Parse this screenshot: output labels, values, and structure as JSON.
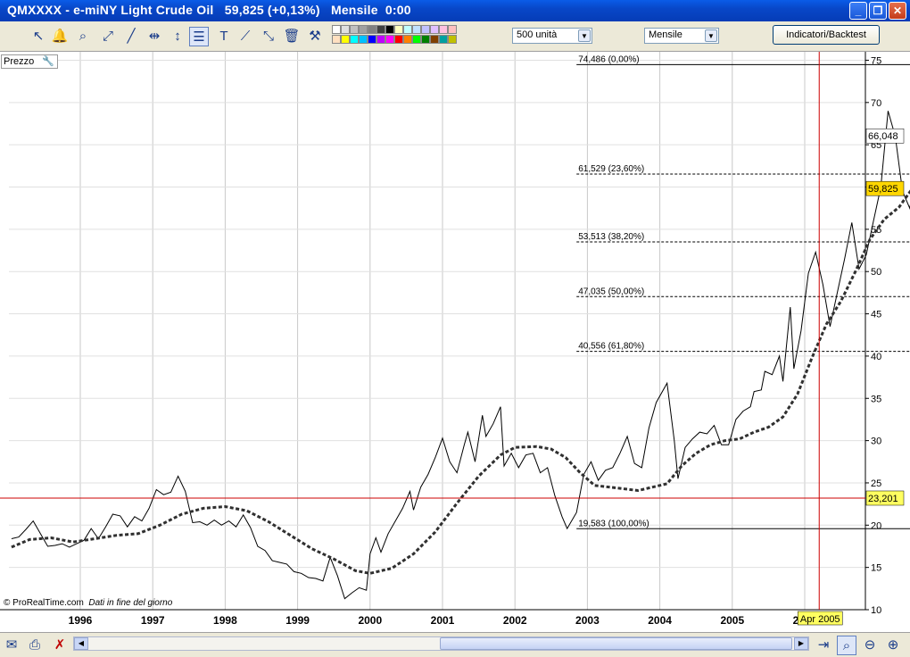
{
  "window": {
    "title": "QMXXXX - e-miNY Light Crude Oil   59,825 (+0,13%)   Mensile  0:00",
    "buttons": {
      "minimize": "_",
      "maximize": "❐",
      "close": "✕"
    }
  },
  "toolbar": {
    "units_select": "500 unità",
    "period_select": "Mensile",
    "indicators_button": "Indicatori/Backtest",
    "palette_colors": [
      "#ffffff",
      "#e0e0e0",
      "#c0c0c0",
      "#a0a0a0",
      "#808080",
      "#404040",
      "#000000",
      "#ffffc0",
      "#c0ffff",
      "#c0e0ff",
      "#c0c0ff",
      "#e0c0ff",
      "#ffc0e0",
      "#ffc0c0",
      "#ffe0c0",
      "#ffff00",
      "#00ffff",
      "#00c0ff",
      "#0000ff",
      "#c000ff",
      "#ff00ff",
      "#ff0000",
      "#ff8000",
      "#00ff00",
      "#008000",
      "#804000",
      "#00a0a0",
      "#c0c000"
    ]
  },
  "panel": {
    "price_label": "Prezzo",
    "source_note": "© ProRealTime.com",
    "data_note": "Dati in fine del giorno"
  },
  "chart_data": {
    "type": "line",
    "x_ticks": [
      "1996",
      "1997",
      "1998",
      "1999",
      "2000",
      "2001",
      "2002",
      "2003",
      "2004",
      "2005",
      "2006"
    ],
    "y_ticks": [
      "10",
      "15",
      "20",
      "25",
      "30",
      "35",
      "40",
      "45",
      "50",
      "55",
      "60",
      "65",
      "70",
      "75"
    ],
    "ylim": [
      10,
      76
    ],
    "xlim": [
      1995.0,
      2006.9
    ],
    "grid": true,
    "series": [
      {
        "role": "price",
        "color": "#000000",
        "style": "solid",
        "points": [
          [
            1995.05,
            18.4
          ],
          [
            1995.15,
            18.6
          ],
          [
            1995.25,
            19.5
          ],
          [
            1995.35,
            20.5
          ],
          [
            1995.45,
            19.0
          ],
          [
            1995.55,
            17.5
          ],
          [
            1995.65,
            17.6
          ],
          [
            1995.75,
            17.8
          ],
          [
            1995.85,
            17.4
          ],
          [
            1995.95,
            17.8
          ],
          [
            1996.05,
            18.2
          ],
          [
            1996.15,
            19.6
          ],
          [
            1996.25,
            18.4
          ],
          [
            1996.35,
            19.8
          ],
          [
            1996.45,
            21.3
          ],
          [
            1996.55,
            21.1
          ],
          [
            1996.65,
            19.8
          ],
          [
            1996.75,
            21.0
          ],
          [
            1996.85,
            20.5
          ],
          [
            1996.95,
            22.0
          ],
          [
            1997.05,
            24.2
          ],
          [
            1997.15,
            23.6
          ],
          [
            1997.25,
            23.9
          ],
          [
            1997.35,
            25.8
          ],
          [
            1997.45,
            24.0
          ],
          [
            1997.55,
            20.3
          ],
          [
            1997.65,
            20.4
          ],
          [
            1997.75,
            20.0
          ],
          [
            1997.85,
            20.6
          ],
          [
            1997.95,
            20.0
          ],
          [
            1998.05,
            20.5
          ],
          [
            1998.15,
            19.8
          ],
          [
            1998.25,
            21.2
          ],
          [
            1998.35,
            19.7
          ],
          [
            1998.45,
            17.5
          ],
          [
            1998.55,
            17.0
          ],
          [
            1998.65,
            15.8
          ],
          [
            1998.75,
            15.6
          ],
          [
            1998.85,
            15.4
          ],
          [
            1998.95,
            14.5
          ],
          [
            1999.05,
            14.3
          ],
          [
            1999.15,
            13.8
          ],
          [
            1999.25,
            13.7
          ],
          [
            1999.35,
            13.4
          ],
          [
            1999.45,
            16.2
          ],
          [
            1999.55,
            14.0
          ],
          [
            1999.65,
            11.3
          ],
          [
            1999.75,
            12.0
          ],
          [
            1999.85,
            12.6
          ],
          [
            1999.95,
            12.3
          ],
          [
            2000.0,
            16.6
          ],
          [
            2000.08,
            18.5
          ],
          [
            2000.15,
            16.8
          ],
          [
            2000.25,
            19.0
          ],
          [
            2000.35,
            20.5
          ],
          [
            2000.45,
            22.0
          ],
          [
            2000.55,
            24.0
          ],
          [
            2000.6,
            21.8
          ],
          [
            2000.7,
            24.5
          ],
          [
            2000.8,
            26.0
          ],
          [
            2000.9,
            28.0
          ],
          [
            2001.0,
            30.3
          ],
          [
            2001.1,
            27.5
          ],
          [
            2001.2,
            26.2
          ],
          [
            2001.3,
            29.5
          ],
          [
            2001.35,
            31.0
          ],
          [
            2001.45,
            27.5
          ],
          [
            2001.55,
            33.0
          ],
          [
            2001.6,
            30.5
          ],
          [
            2001.7,
            32.0
          ],
          [
            2001.8,
            34.0
          ],
          [
            2001.85,
            27.0
          ],
          [
            2001.95,
            28.5
          ],
          [
            2002.05,
            26.8
          ],
          [
            2002.15,
            28.3
          ],
          [
            2002.25,
            28.5
          ],
          [
            2002.35,
            26.2
          ],
          [
            2002.45,
            26.8
          ],
          [
            2002.55,
            23.5
          ],
          [
            2002.65,
            21.0
          ],
          [
            2002.72,
            19.6
          ],
          [
            2002.85,
            21.5
          ],
          [
            2002.95,
            26.0
          ],
          [
            2003.05,
            27.5
          ],
          [
            2003.15,
            25.3
          ],
          [
            2003.25,
            26.5
          ],
          [
            2003.35,
            26.8
          ],
          [
            2003.45,
            28.5
          ],
          [
            2003.55,
            30.5
          ],
          [
            2003.65,
            27.3
          ],
          [
            2003.75,
            26.8
          ],
          [
            2003.85,
            31.5
          ],
          [
            2003.95,
            34.5
          ],
          [
            2004.1,
            36.8
          ],
          [
            2004.2,
            30.0
          ],
          [
            2004.25,
            25.5
          ],
          [
            2004.35,
            29.2
          ],
          [
            2004.45,
            30.2
          ],
          [
            2004.55,
            31.0
          ],
          [
            2004.65,
            30.8
          ],
          [
            2004.75,
            31.8
          ],
          [
            2004.85,
            29.5
          ],
          [
            2004.95,
            29.5
          ],
          [
            2005.05,
            32.5
          ],
          [
            2005.15,
            33.5
          ],
          [
            2005.25,
            34.0
          ],
          [
            2005.3,
            35.8
          ],
          [
            2005.4,
            36.0
          ],
          [
            2005.45,
            38.2
          ],
          [
            2005.55,
            37.8
          ],
          [
            2005.65,
            40.0
          ],
          [
            2005.7,
            37.0
          ],
          [
            2005.8,
            45.8
          ],
          [
            2005.85,
            38.5
          ],
          [
            2005.95,
            43.0
          ],
          [
            2006.05,
            49.8
          ],
          [
            2006.15,
            52.3
          ],
          [
            2006.25,
            48.5
          ],
          [
            2006.35,
            43.5
          ],
          [
            2006.45,
            47.5
          ],
          [
            2006.55,
            51.5
          ],
          [
            2006.65,
            55.8
          ],
          [
            2006.75,
            50.3
          ],
          [
            2006.85,
            52.0
          ],
          [
            2006.95,
            56.0
          ],
          [
            2007.05,
            60.0
          ],
          [
            2007.15,
            69.0
          ],
          [
            2007.25,
            66.0
          ],
          [
            2007.35,
            59.5
          ],
          [
            2007.45,
            57.5
          ],
          [
            2007.55,
            62.0
          ],
          [
            2007.65,
            67.5
          ],
          [
            2007.75,
            61.5
          ],
          [
            2007.85,
            67.0
          ],
          [
            2007.95,
            72.0
          ],
          [
            2008.05,
            71.5
          ],
          [
            2008.15,
            73.5
          ],
          [
            2008.25,
            74.5
          ],
          [
            2008.35,
            69.5
          ],
          [
            2008.45,
            63.0
          ],
          [
            2008.55,
            59.8
          ]
        ]
      },
      {
        "role": "moving-average",
        "color": "#303030",
        "style": "dashed",
        "points": [
          [
            1995.05,
            17.4
          ],
          [
            1995.3,
            18.3
          ],
          [
            1995.6,
            18.5
          ],
          [
            1995.9,
            18.0
          ],
          [
            1996.2,
            18.4
          ],
          [
            1996.5,
            18.8
          ],
          [
            1996.8,
            19.0
          ],
          [
            1997.1,
            20.0
          ],
          [
            1997.4,
            21.3
          ],
          [
            1997.7,
            22.0
          ],
          [
            1998.0,
            22.2
          ],
          [
            1998.3,
            21.7
          ],
          [
            1998.6,
            20.4
          ],
          [
            1998.9,
            18.8
          ],
          [
            1999.2,
            17.2
          ],
          [
            1999.5,
            16.0
          ],
          [
            1999.8,
            14.6
          ],
          [
            2000.0,
            14.3
          ],
          [
            2000.3,
            14.9
          ],
          [
            2000.6,
            16.6
          ],
          [
            2000.9,
            19.2
          ],
          [
            2001.2,
            22.6
          ],
          [
            2001.5,
            25.8
          ],
          [
            2001.8,
            28.3
          ],
          [
            2002.0,
            29.2
          ],
          [
            2002.3,
            29.3
          ],
          [
            2002.5,
            29.0
          ],
          [
            2002.7,
            28.0
          ],
          [
            2002.9,
            26.2
          ],
          [
            2003.1,
            24.7
          ],
          [
            2003.4,
            24.4
          ],
          [
            2003.7,
            24.1
          ],
          [
            2003.9,
            24.5
          ],
          [
            2004.1,
            24.9
          ],
          [
            2004.3,
            27.0
          ],
          [
            2004.5,
            28.5
          ],
          [
            2004.7,
            29.5
          ],
          [
            2004.9,
            30.0
          ],
          [
            2005.1,
            30.2
          ],
          [
            2005.3,
            31.0
          ],
          [
            2005.5,
            31.6
          ],
          [
            2005.7,
            32.8
          ],
          [
            2005.9,
            35.5
          ],
          [
            2006.1,
            39.8
          ],
          [
            2006.3,
            43.8
          ],
          [
            2006.5,
            46.5
          ],
          [
            2006.7,
            50.0
          ],
          [
            2006.9,
            53.8
          ],
          [
            2007.1,
            56.2
          ],
          [
            2007.3,
            57.6
          ],
          [
            2007.5,
            60.0
          ],
          [
            2007.7,
            62.8
          ],
          [
            2007.9,
            63.9
          ],
          [
            2008.05,
            65.5
          ],
          [
            2008.25,
            66.0
          ],
          [
            2008.45,
            65.8
          ]
        ]
      }
    ],
    "fib_levels": [
      {
        "label": "74,486 (0,00%)",
        "value": 74.486,
        "style": "solid"
      },
      {
        "label": "61,529 (23,60%)",
        "value": 61.529,
        "style": "dashed"
      },
      {
        "label": "53,513 (38,20%)",
        "value": 53.513,
        "style": "dashed"
      },
      {
        "label": "47,035 (50,00%)",
        "value": 47.035,
        "style": "dashed"
      },
      {
        "label": "40,556 (61,80%)",
        "value": 40.556,
        "style": "dashed"
      },
      {
        "label": "19,583 (100,00%)",
        "value": 19.583,
        "style": "solid"
      }
    ],
    "fib_x_range": [
      2002.85,
      2008.4
    ],
    "crosshair": {
      "x": 2006.2,
      "x_label": "Apr 2005",
      "y": 23.201,
      "y_label": "23,201",
      "color": "#cc0000"
    },
    "last_price": {
      "value": 59.825,
      "label": "59,825"
    },
    "ma_value": {
      "value": 66.048,
      "label": "66,048"
    }
  }
}
